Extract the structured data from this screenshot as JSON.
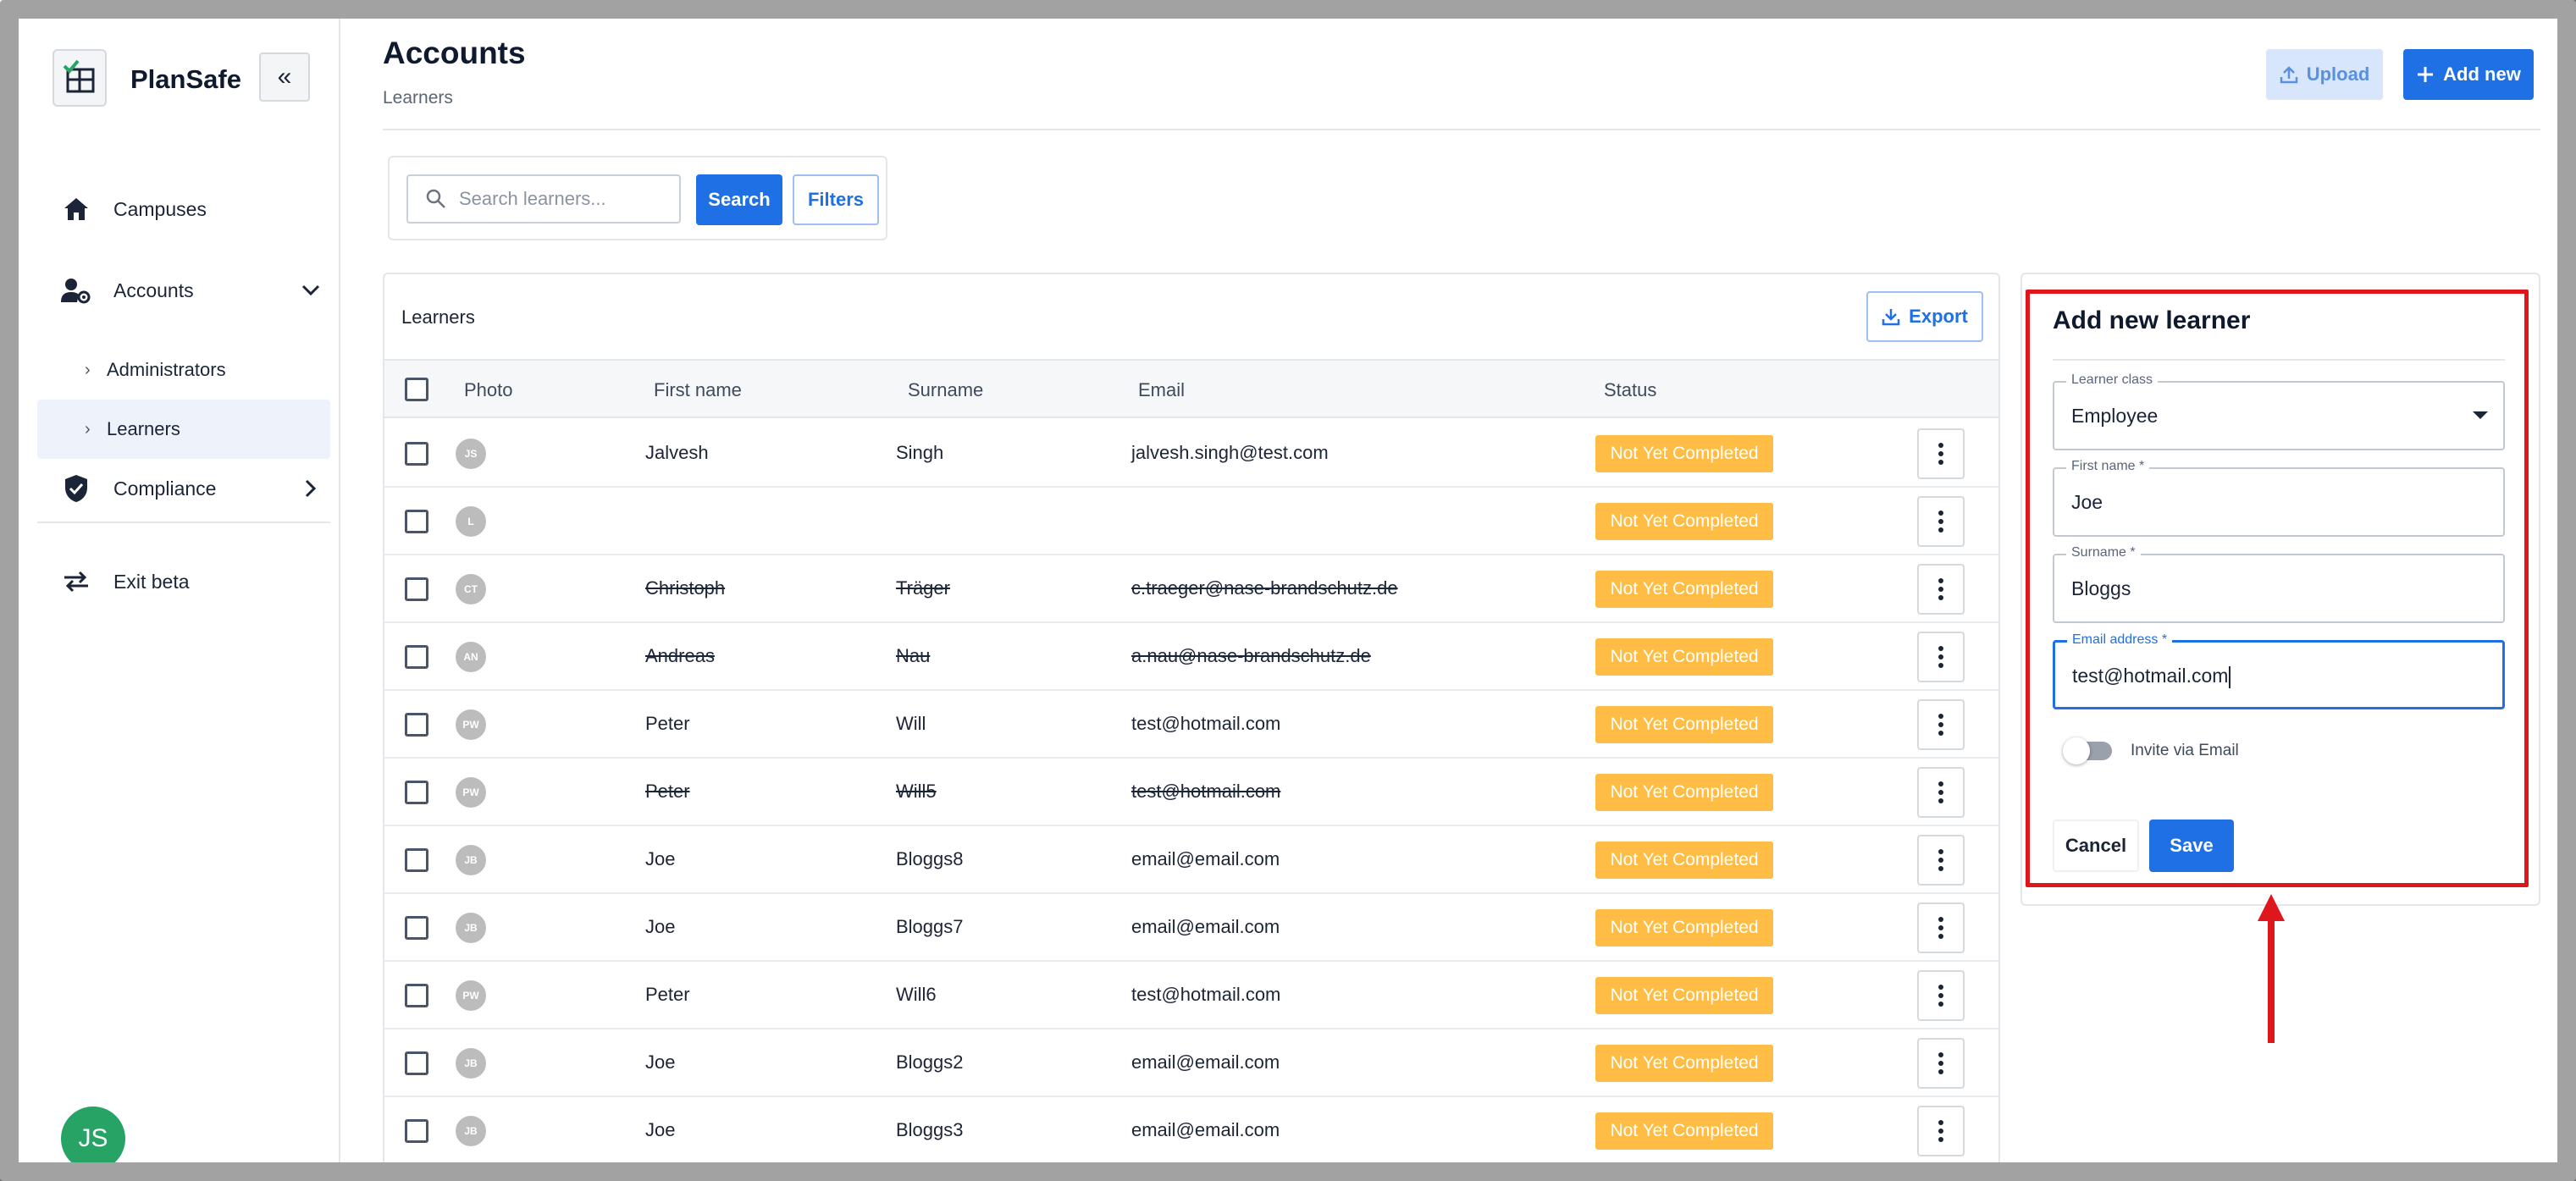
{
  "sidebar": {
    "brand": "PlanSafe",
    "collapse_glyph": "«",
    "items": [
      {
        "label": "Campuses",
        "icon": "home-icon"
      },
      {
        "label": "Accounts",
        "icon": "users-gear-icon"
      },
      {
        "label": "Compliance",
        "icon": "shield-check-icon"
      }
    ],
    "sub_items": [
      {
        "label": "Administrators"
      },
      {
        "label": "Learners",
        "active": true
      }
    ],
    "exit": {
      "label": "Exit beta",
      "icon": "swap-arrows-icon"
    },
    "user_initials": "JS"
  },
  "header": {
    "title": "Accounts",
    "breadcrumb": "Learners",
    "upload_label": "Upload",
    "add_new_label": "Add new"
  },
  "search": {
    "placeholder": "Search learners...",
    "search_label": "Search",
    "filters_label": "Filters"
  },
  "table": {
    "title": "Learners",
    "export_label": "Export",
    "columns": {
      "photo": "Photo",
      "first_name": "First name",
      "surname": "Surname",
      "email": "Email",
      "status": "Status"
    },
    "rows": [
      {
        "initials": "JS",
        "first": "Jalvesh",
        "surname": "Singh",
        "email": "jalvesh.singh@test.com",
        "status": "Not Yet Completed",
        "struck": false
      },
      {
        "initials": "L",
        "first": "",
        "surname": "",
        "email": "",
        "status": "Not Yet Completed",
        "struck": false
      },
      {
        "initials": "CT",
        "first": "Christoph",
        "surname": "Träger",
        "email": "c.traeger@nase-brandschutz.de",
        "status": "Not Yet Completed",
        "struck": true
      },
      {
        "initials": "AN",
        "first": "Andreas",
        "surname": "Nau",
        "email": "a.nau@nase-brandschutz.de",
        "status": "Not Yet Completed",
        "struck": true
      },
      {
        "initials": "PW",
        "first": "Peter",
        "surname": "Will",
        "email": "test@hotmail.com",
        "status": "Not Yet Completed",
        "struck": false
      },
      {
        "initials": "PW",
        "first": "Peter",
        "surname": "Will5",
        "email": "test@hotmail.com",
        "status": "Not Yet Completed",
        "struck": true
      },
      {
        "initials": "JB",
        "first": "Joe",
        "surname": "Bloggs8",
        "email": "email@email.com",
        "status": "Not Yet Completed",
        "struck": false
      },
      {
        "initials": "JB",
        "first": "Joe",
        "surname": "Bloggs7",
        "email": "email@email.com",
        "status": "Not Yet Completed",
        "struck": false
      },
      {
        "initials": "PW",
        "first": "Peter",
        "surname": "Will6",
        "email": "test@hotmail.com",
        "status": "Not Yet Completed",
        "struck": false
      },
      {
        "initials": "JB",
        "first": "Joe",
        "surname": "Bloggs2",
        "email": "email@email.com",
        "status": "Not Yet Completed",
        "struck": false
      },
      {
        "initials": "JB",
        "first": "Joe",
        "surname": "Bloggs3",
        "email": "email@email.com",
        "status": "Not Yet Completed",
        "struck": false
      }
    ]
  },
  "form": {
    "title": "Add new learner",
    "learner_class": {
      "label": "Learner class",
      "value": "Employee"
    },
    "first_name": {
      "label": "First name *",
      "value": "Joe"
    },
    "surname": {
      "label": "Surname *",
      "value": "Bloggs"
    },
    "email": {
      "label": "Email address *",
      "value": "test@hotmail.com"
    },
    "invite_label": "Invite via Email",
    "invite_enabled": false,
    "cancel_label": "Cancel",
    "save_label": "Save"
  },
  "colors": {
    "primary": "#1f6fe5",
    "status_pending": "#ffbd45",
    "highlight": "#e0161d",
    "avatar_green": "#27a465"
  }
}
